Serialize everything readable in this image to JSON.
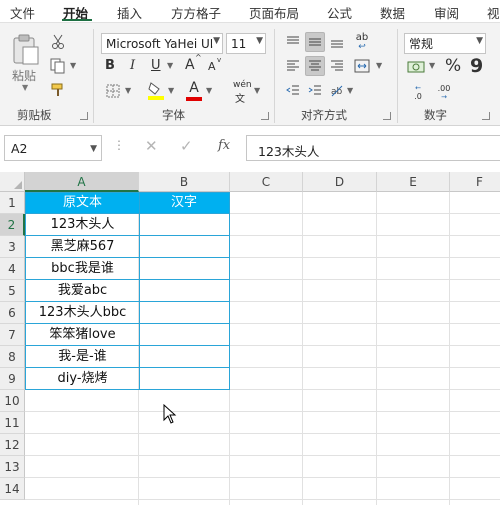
{
  "ribbon_tabs": [
    {
      "label": "文件",
      "active": false
    },
    {
      "label": "开始",
      "active": true
    },
    {
      "label": "插入",
      "active": false
    },
    {
      "label": "方方格子",
      "active": false
    },
    {
      "label": "页面布局",
      "active": false
    },
    {
      "label": "公式",
      "active": false
    },
    {
      "label": "数据",
      "active": false
    },
    {
      "label": "审阅",
      "active": false
    },
    {
      "label": "视",
      "active": false
    }
  ],
  "clipboard": {
    "paste_label": "粘贴",
    "group_label": "剪贴板"
  },
  "font": {
    "name": "Microsoft YaHei UI",
    "size": "11",
    "group_label": "字体",
    "bold": "B",
    "italic": "I",
    "underline": "U",
    "grow": "A",
    "shrink": "A",
    "font_color_letter": "A",
    "phonetic": "wén"
  },
  "alignment": {
    "group_label": "对齐方式",
    "wrap": "ab"
  },
  "number": {
    "format": "常规",
    "percent": "%",
    "comma": "9",
    "group_label": "数字",
    "inc_decimal": ".0",
    "dec_decimal": ".00"
  },
  "formula_bar": {
    "cell_ref": "A2",
    "fx": "fx",
    "content": "123木头人"
  },
  "columns": [
    "A",
    "B",
    "C",
    "D",
    "E",
    "F"
  ],
  "rows": [
    "1",
    "2",
    "3",
    "4",
    "5",
    "6",
    "7",
    "8",
    "9",
    "10",
    "11",
    "12",
    "13",
    "14"
  ],
  "sheet": {
    "headers": [
      "原文本",
      "汉字"
    ],
    "values": [
      "123木头人",
      "黑芝麻567",
      "bbc我是谁",
      "我爱abc",
      "123木头人bbc",
      "笨笨猪love",
      "我-是-谁",
      "diy-烧烤"
    ]
  },
  "colors": {
    "accent": "#217346",
    "header_fill": "#00b0f0",
    "table_border": "#2aa5d8"
  }
}
